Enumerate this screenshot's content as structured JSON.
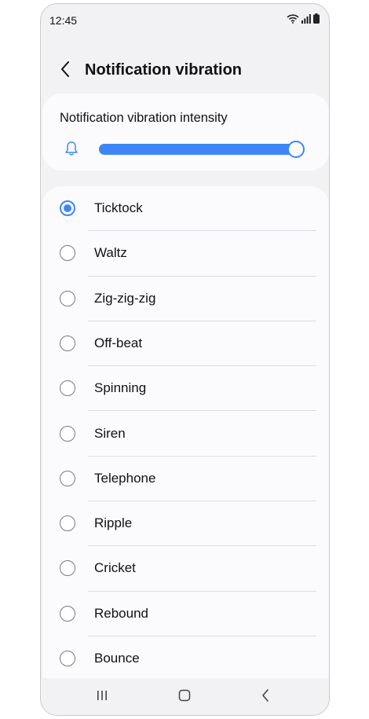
{
  "status_bar": {
    "time": "12:45",
    "icons": [
      "wifi-icon",
      "signal-icon",
      "battery-icon"
    ]
  },
  "header": {
    "back_icon": "chevron-left-icon",
    "title": "Notification vibration"
  },
  "intensity": {
    "label": "Notification vibration intensity",
    "icon": "bell-icon",
    "value_fraction": 1.0
  },
  "options": [
    {
      "label": "Ticktock",
      "selected": true
    },
    {
      "label": "Waltz",
      "selected": false
    },
    {
      "label": "Zig-zig-zig",
      "selected": false
    },
    {
      "label": "Off-beat",
      "selected": false
    },
    {
      "label": "Spinning",
      "selected": false
    },
    {
      "label": "Siren",
      "selected": false
    },
    {
      "label": "Telephone",
      "selected": false
    },
    {
      "label": "Ripple",
      "selected": false
    },
    {
      "label": "Cricket",
      "selected": false
    },
    {
      "label": "Rebound",
      "selected": false
    },
    {
      "label": "Bounce",
      "selected": false
    }
  ],
  "nav_bar": {
    "icons": [
      "recents-icon",
      "home-icon",
      "back-icon"
    ]
  },
  "colors": {
    "accent": "#3e86f5",
    "background": "#f2f2f4",
    "card": "#fbfbfd"
  }
}
